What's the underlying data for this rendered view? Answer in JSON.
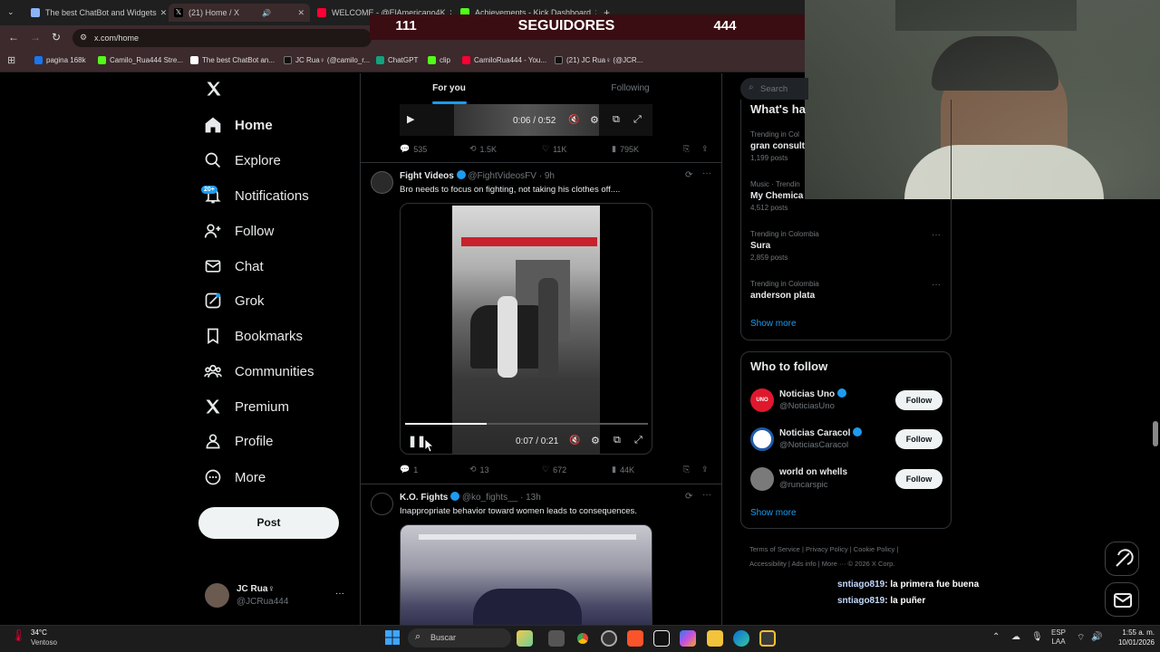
{
  "browser": {
    "tabs": [
      {
        "label": "The best ChatBot and Widgets",
        "color": "#8ab4f8"
      },
      {
        "label": "(21) Home / X",
        "color": "#ffffff"
      },
      {
        "label": "WELCOME - @ElAmericano4K",
        "color": "#ff0033"
      },
      {
        "label": "Achievements - Kick Dashboard",
        "color": "#53fc18"
      }
    ],
    "url": "x.com/home",
    "bookmarks": [
      {
        "label": "pagina 168k",
        "color": "#1877f2"
      },
      {
        "label": "Camilo_Rua444 Stre...",
        "color": "#53fc18"
      },
      {
        "label": "The best ChatBot an...",
        "color": "#ffffff"
      },
      {
        "label": "JC Rua♀ (@camilo_r...",
        "color": "#111111"
      },
      {
        "label": "ChatGPT",
        "color": "#10a37f"
      },
      {
        "label": "clip",
        "color": "#53fc18"
      },
      {
        "label": "CamiloRua444 - You...",
        "color": "#ff0033"
      },
      {
        "label": "(21) JC Rua♀ (@JCR...",
        "color": "#111111"
      }
    ]
  },
  "overlay": {
    "left_count": "111",
    "title": "SEGUIDORES",
    "right_count": "444"
  },
  "nav": {
    "items": [
      {
        "label": "Home",
        "icon": "home-icon"
      },
      {
        "label": "Explore",
        "icon": "search-icon"
      },
      {
        "label": "Notifications",
        "icon": "bell-icon"
      },
      {
        "label": "Follow",
        "icon": "person-add-icon"
      },
      {
        "label": "Chat",
        "icon": "mail-icon"
      },
      {
        "label": "Grok",
        "icon": "grok-icon"
      },
      {
        "label": "Bookmarks",
        "icon": "bookmark-icon"
      },
      {
        "label": "Communities",
        "icon": "communities-icon"
      },
      {
        "label": "Premium",
        "icon": "x-logo-icon"
      },
      {
        "label": "Profile",
        "icon": "person-icon"
      },
      {
        "label": "More",
        "icon": "more-circle-icon"
      }
    ],
    "notif_badge": "20+",
    "post_label": "Post",
    "account": {
      "name": "JC Rua♀",
      "handle": "@JCRua444"
    }
  },
  "feed": {
    "tabs": [
      "For you",
      "Following"
    ],
    "top_post": {
      "video_time": "0:06 / 0:52",
      "replies": "535",
      "reposts": "1.5K",
      "likes": "11K",
      "views": "795K"
    },
    "posts": [
      {
        "name": "Fight Videos",
        "handle": "@FightVideosFV",
        "time": "· 9h",
        "text": "Bro needs to focus on fighting, not taking his clothes off....",
        "video_time": "0:07 / 0:21",
        "replies": "1",
        "reposts": "13",
        "likes": "672",
        "views": "44K"
      },
      {
        "name": "K.O. Fights",
        "handle": "@ko_fights__",
        "time": "· 13h",
        "text": "Inappropriate behavior toward women leads to consequences."
      }
    ]
  },
  "right": {
    "search_placeholder": "Search",
    "trends_title": "What's ha",
    "trends": [
      {
        "context": "Trending in Col",
        "name": "gran consult",
        "posts": "1,199 posts"
      },
      {
        "context": "Music · Trendin",
        "name": "My Chemica",
        "posts": "4,512 posts"
      },
      {
        "context": "Trending in Colombia",
        "name": "Sura",
        "posts": "2,859 posts"
      },
      {
        "context": "Trending in Colombia",
        "name": "anderson plata",
        "posts": ""
      }
    ],
    "show_more": "Show more",
    "who_to_follow_title": "Who to follow",
    "suggestions": [
      {
        "name": "Noticias Uno",
        "handle": "@NoticiasUno",
        "button": "Follow"
      },
      {
        "name": "Noticias Caracol",
        "handle": "@NoticiasCaracol",
        "button": "Follow"
      },
      {
        "name": "world on whells",
        "handle": "@runcarspic",
        "button": "Follow"
      }
    ],
    "footer": {
      "line1": [
        "Terms of Service",
        "Privacy Policy",
        "Cookie Policy"
      ],
      "line2": [
        "Accessibility",
        "Ads info",
        "More ···",
        "© 2026 X Corp."
      ]
    }
  },
  "chat_overlay": [
    {
      "user": "sntiago819",
      "message": ": la primera fue buena"
    },
    {
      "user": "sntiago819",
      "message": ": la puñer"
    }
  ],
  "taskbar": {
    "weather_temp": "34°C",
    "weather_desc": "Ventoso",
    "search_placeholder": "Buscar",
    "lang_top": "ESP",
    "lang_bottom": "LAA",
    "time": "1:55 a. m.",
    "date": "10/01/2026"
  }
}
